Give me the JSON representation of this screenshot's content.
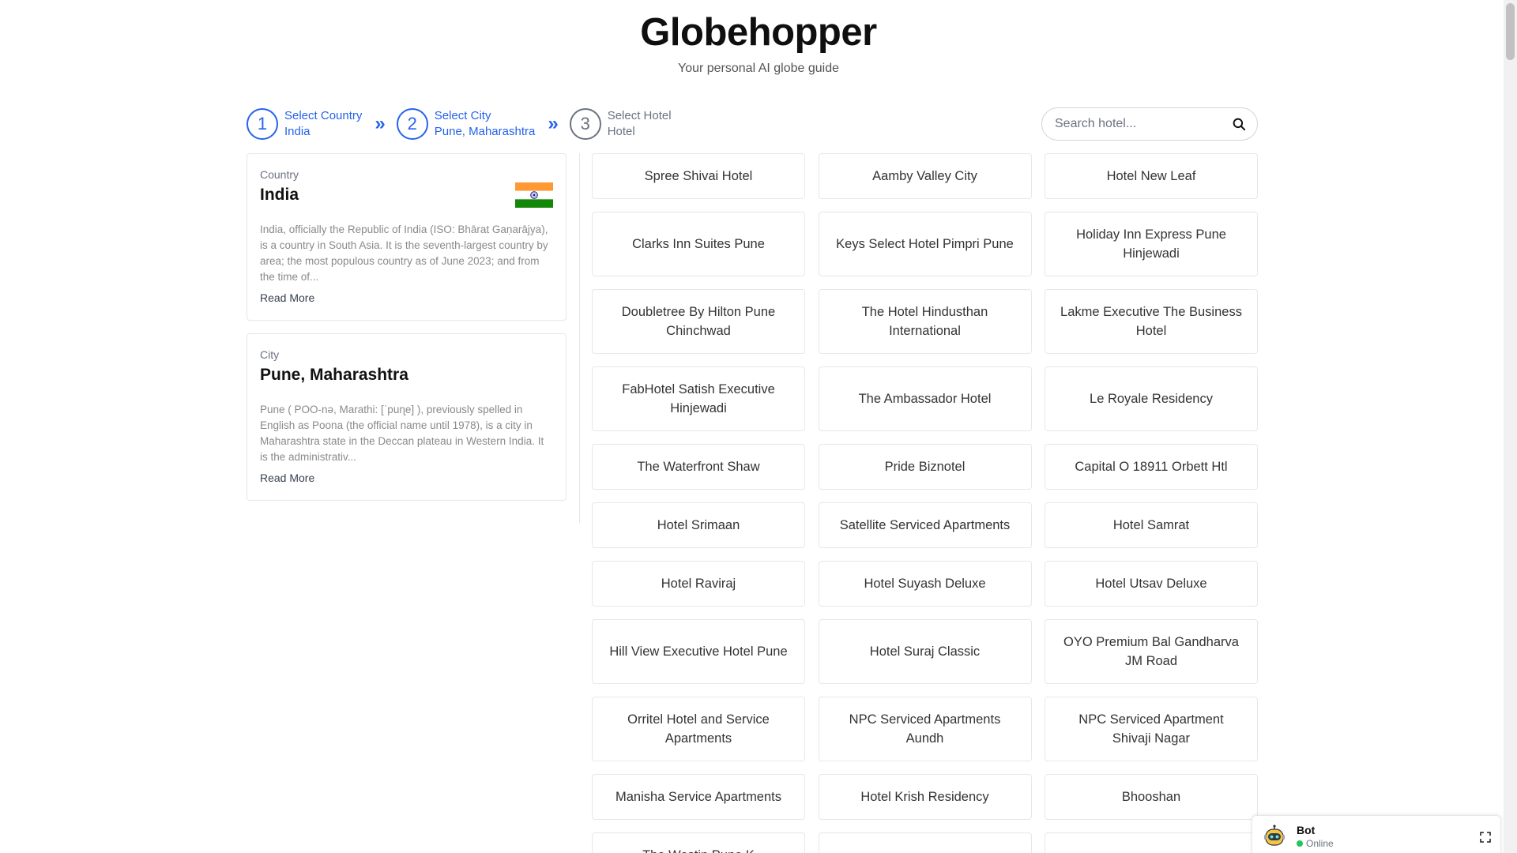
{
  "header": {
    "title": "Globehopper",
    "subtitle": "Your personal AI globe guide"
  },
  "stepper": {
    "steps": [
      {
        "number": "1",
        "title": "Select Country",
        "value": "India"
      },
      {
        "number": "2",
        "title": "Select City",
        "value": "Pune, Maharashtra"
      },
      {
        "number": "3",
        "title": "Select Hotel",
        "value": "Hotel"
      }
    ],
    "separator": "»"
  },
  "search": {
    "placeholder": "Search hotel..."
  },
  "country_card": {
    "label": "Country",
    "name": "India",
    "description": "India, officially the Republic of India (ISO: Bhārat Gaṇarājya), is a country in South Asia. It is the seventh-largest country by area; the most populous country as of June 2023; and from the time of...",
    "read_more": "Read More",
    "flag_colors": {
      "saffron": "#ff9933",
      "white": "#ffffff",
      "green": "#138808",
      "chakra": "#000080"
    }
  },
  "city_card": {
    "label": "City",
    "name": "Pune, Maharashtra",
    "description": "Pune ( POO-nə, Marathi: [ˈpuɳe] ), previously spelled in English as Poona (the official name until 1978), is a city in Maharashtra state in the Deccan plateau in Western India. It is the administrativ...",
    "read_more": "Read More"
  },
  "hotels": [
    "Spree Shivai Hotel",
    "Aamby Valley City",
    "Hotel New Leaf",
    "Clarks Inn Suites Pune",
    "Keys Select Hotel Pimpri Pune",
    "Holiday Inn Express Pune Hinjewadi",
    "Doubletree By Hilton Pune Chinchwad",
    "The Hotel Hindusthan International",
    "Lakme Executive The Business Hotel",
    "FabHotel Satish Executive Hinjewadi",
    "The Ambassador Hotel",
    "Le Royale Residency",
    "The Waterfront Shaw",
    "Pride Biznotel",
    "Capital O 18911 Orbett Htl",
    "Hotel Srimaan",
    "Satellite Serviced Apartments",
    "Hotel Samrat",
    "Hotel Raviraj",
    "Hotel Suyash Deluxe",
    "Hotel Utsav Deluxe",
    "Hill View Executive Hotel Pune",
    "Hotel Suraj Classic",
    "OYO Premium Bal Gandharva JM Road",
    "Orritel Hotel and Service Apartments",
    "NPC Serviced Apartments Aundh",
    "NPC Serviced Apartment Shivaji Nagar",
    "Manisha Service Apartments",
    "Hotel Krish Residency",
    "Bhooshan",
    "The Westin Pune K",
    "",
    ""
  ],
  "bot": {
    "name": "Bot",
    "status": "Online",
    "status_color": "#22c55e"
  },
  "colors": {
    "accent": "#2563eb",
    "inactive": "#6b7280"
  }
}
